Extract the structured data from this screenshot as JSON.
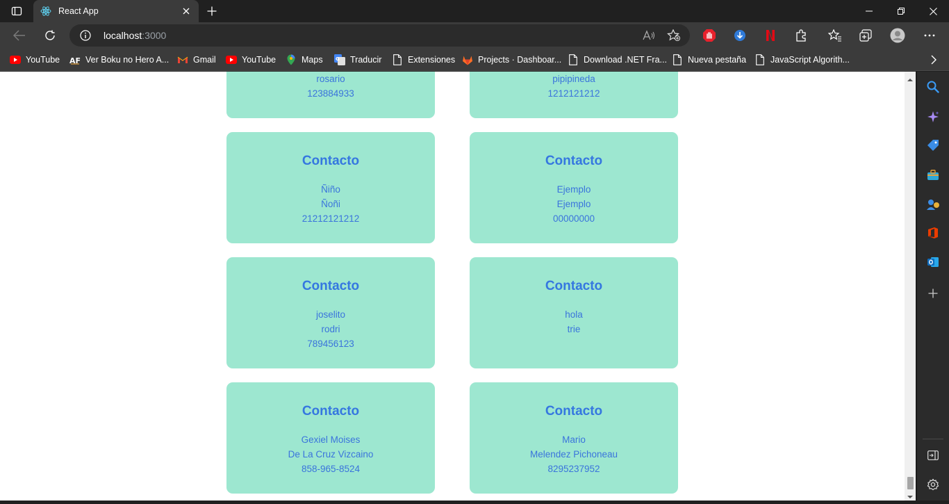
{
  "browser": {
    "tab_title": "React App",
    "url_host": "localhost",
    "url_port": ":3000"
  },
  "bookmarks": [
    {
      "label": "YouTube",
      "icon": "youtube-icon"
    },
    {
      "label": "Ver Boku no Hero A...",
      "icon": "af-icon"
    },
    {
      "label": "Gmail",
      "icon": "gmail-icon"
    },
    {
      "label": "YouTube",
      "icon": "youtube-icon"
    },
    {
      "label": "Maps",
      "icon": "maps-icon"
    },
    {
      "label": "Traducir",
      "icon": "translate-icon"
    },
    {
      "label": "Extensiones",
      "icon": "page-icon"
    },
    {
      "label": "Projects · Dashboar...",
      "icon": "gitlab-icon"
    },
    {
      "label": "Download .NET Fra...",
      "icon": "page-icon"
    },
    {
      "label": "Nueva pestaña",
      "icon": "page-icon"
    },
    {
      "label": "JavaScript Algorith...",
      "icon": "page-icon"
    }
  ],
  "cards": [
    {
      "title": "",
      "lines": [
        "rosario",
        "123884933"
      ]
    },
    {
      "title": "",
      "lines": [
        "pipipineda",
        "1212121212"
      ]
    },
    {
      "title": "Contacto",
      "lines": [
        "Ñiño",
        "Ñoñi",
        "21212121212"
      ]
    },
    {
      "title": "Contacto",
      "lines": [
        "Ejemplo",
        "Ejemplo",
        "00000000"
      ]
    },
    {
      "title": "Contacto",
      "lines": [
        "joselito",
        "rodri",
        "789456123"
      ]
    },
    {
      "title": "Contacto",
      "lines": [
        "hola",
        "trie"
      ]
    },
    {
      "title": "Contacto",
      "lines": [
        "Gexiel Moises",
        "De La Cruz Vizcaino",
        "858-965-8524"
      ]
    },
    {
      "title": "Contacto",
      "lines": [
        "Mario",
        "Melendez Pichoneau",
        "8295237952"
      ]
    }
  ],
  "colors": {
    "card_bg": "#9de7d0",
    "card_text": "#3577e0"
  }
}
